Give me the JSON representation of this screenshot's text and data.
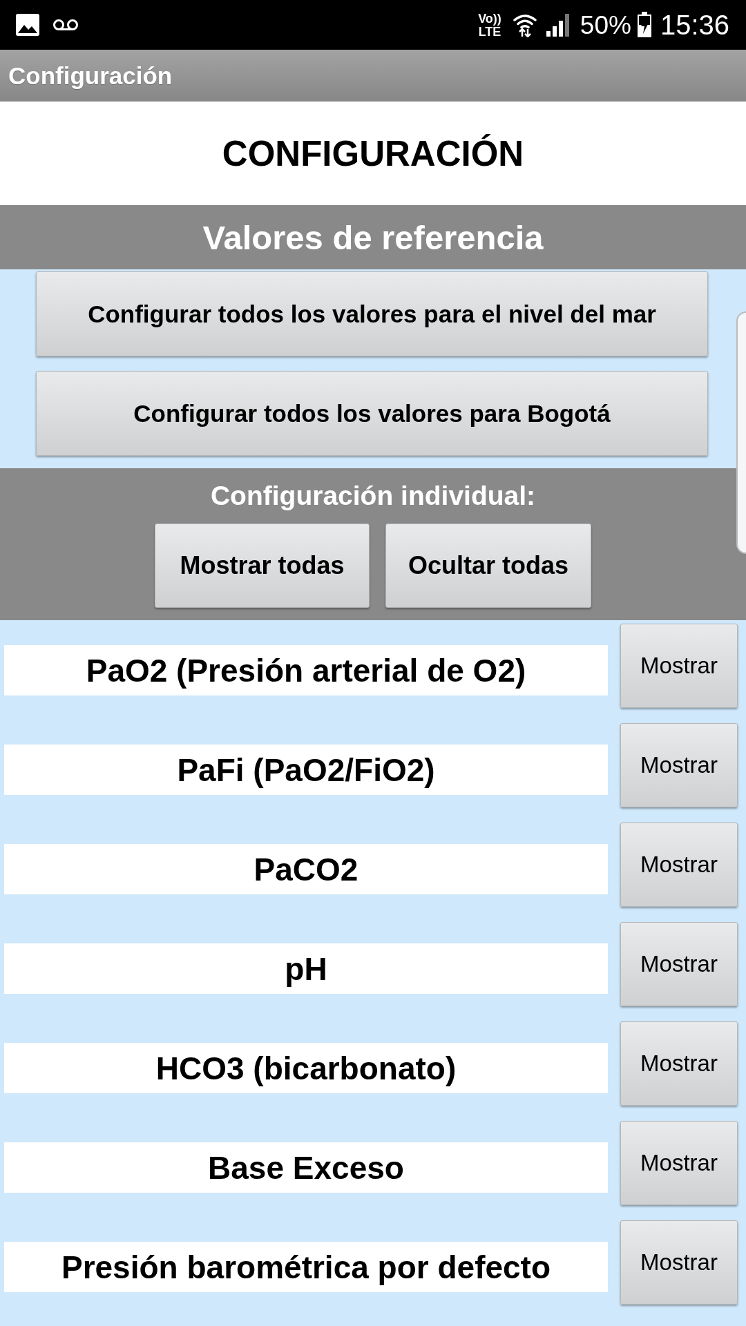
{
  "status_bar": {
    "volte_top": "Vo))",
    "volte_bottom": "LTE",
    "battery": "50%",
    "time": "15:36"
  },
  "action_bar": {
    "title": "Configuración"
  },
  "header": {
    "title": "CONFIGURACIÓN"
  },
  "reference_values": {
    "title": "Valores de referencia",
    "buttons": [
      "Configurar todos los valores para el nivel del mar",
      "Configurar todos los valores para Bogotá"
    ]
  },
  "individual": {
    "title": "Configuración individual:",
    "buttons": [
      "Mostrar todas",
      "Ocultar todas"
    ]
  },
  "parameters": [
    {
      "label": "PaO2 (Presión arterial de O2)",
      "button": "Mostrar"
    },
    {
      "label": "PaFi (PaO2/FiO2)",
      "button": "Mostrar"
    },
    {
      "label": "PaCO2",
      "button": "Mostrar"
    },
    {
      "label": "pH",
      "button": "Mostrar"
    },
    {
      "label": "HCO3 (bicarbonato)",
      "button": "Mostrar"
    },
    {
      "label": "Base Exceso",
      "button": "Mostrar"
    },
    {
      "label": "Presión barométrica por defecto",
      "button": "Mostrar"
    }
  ]
}
